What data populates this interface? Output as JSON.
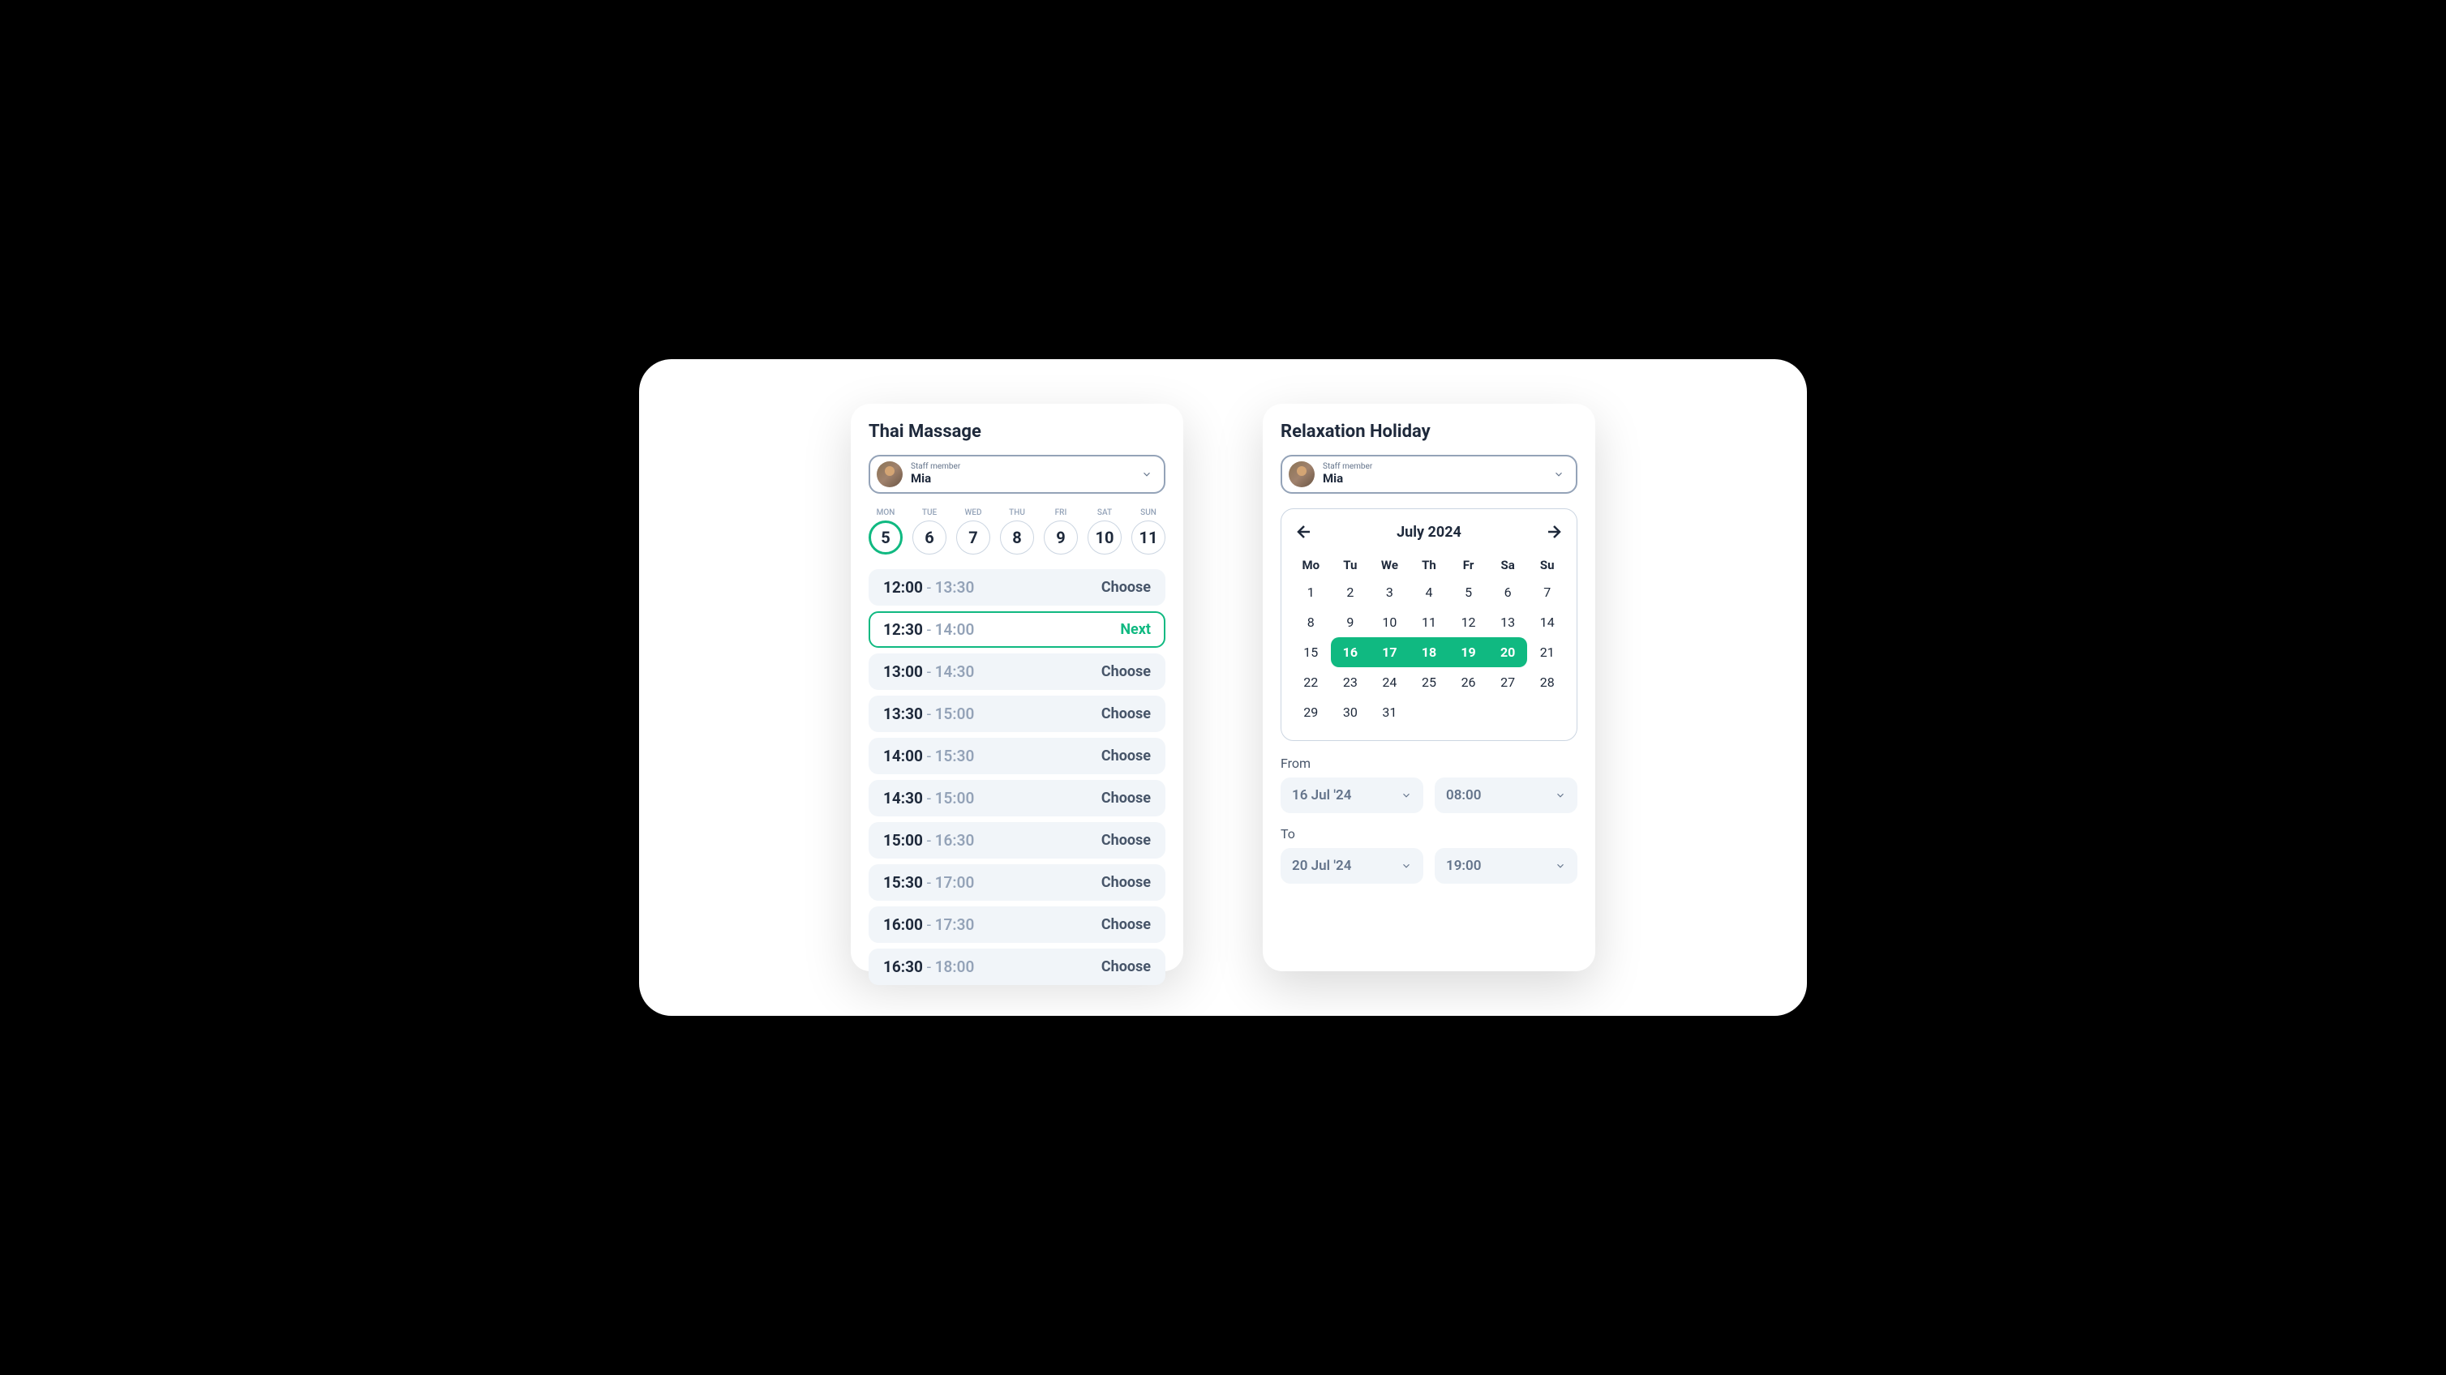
{
  "left": {
    "title": "Thai Massage",
    "staff": {
      "label": "Staff member",
      "name": "Mia"
    },
    "days": [
      {
        "label": "MON",
        "num": "5",
        "selected": true
      },
      {
        "label": "TUE",
        "num": "6",
        "selected": false
      },
      {
        "label": "WED",
        "num": "7",
        "selected": false
      },
      {
        "label": "THU",
        "num": "8",
        "selected": false
      },
      {
        "label": "FRI",
        "num": "9",
        "selected": false
      },
      {
        "label": "SAT",
        "num": "10",
        "selected": false
      },
      {
        "label": "SUN",
        "num": "11",
        "selected": false
      }
    ],
    "slots": [
      {
        "start": "12:00",
        "end": "13:30",
        "action": "Choose",
        "selected": false
      },
      {
        "start": "12:30",
        "end": "14:00",
        "action": "Next",
        "selected": true
      },
      {
        "start": "13:00",
        "end": "14:30",
        "action": "Choose",
        "selected": false
      },
      {
        "start": "13:30",
        "end": "15:00",
        "action": "Choose",
        "selected": false
      },
      {
        "start": "14:00",
        "end": "15:30",
        "action": "Choose",
        "selected": false
      },
      {
        "start": "14:30",
        "end": "15:00",
        "action": "Choose",
        "selected": false
      },
      {
        "start": "15:00",
        "end": "16:30",
        "action": "Choose",
        "selected": false
      },
      {
        "start": "15:30",
        "end": "17:00",
        "action": "Choose",
        "selected": false
      },
      {
        "start": "16:00",
        "end": "17:30",
        "action": "Choose",
        "selected": false
      },
      {
        "start": "16:30",
        "end": "18:00",
        "action": "Choose",
        "selected": false
      }
    ]
  },
  "right": {
    "title": "Relaxation Holiday",
    "staff": {
      "label": "Staff member",
      "name": "Mia"
    },
    "calendar": {
      "month": "July 2024",
      "dayHeaders": [
        "Mo",
        "Tu",
        "We",
        "Th",
        "Fr",
        "Sa",
        "Su"
      ],
      "weeks": [
        [
          "1",
          "2",
          "3",
          "4",
          "5",
          "6",
          "7"
        ],
        [
          "8",
          "9",
          "10",
          "11",
          "12",
          "13",
          "14"
        ],
        [
          "15",
          "16",
          "17",
          "18",
          "19",
          "20",
          "21"
        ],
        [
          "22",
          "23",
          "24",
          "25",
          "26",
          "27",
          "28"
        ],
        [
          "29",
          "30",
          "31",
          "",
          "",
          "",
          ""
        ]
      ],
      "rangeStart": "16",
      "rangeEnd": "20"
    },
    "from": {
      "label": "From",
      "date": "16 Jul '24",
      "time": "08:00"
    },
    "to": {
      "label": "To",
      "date": "20 Jul '24",
      "time": "19:00"
    }
  }
}
